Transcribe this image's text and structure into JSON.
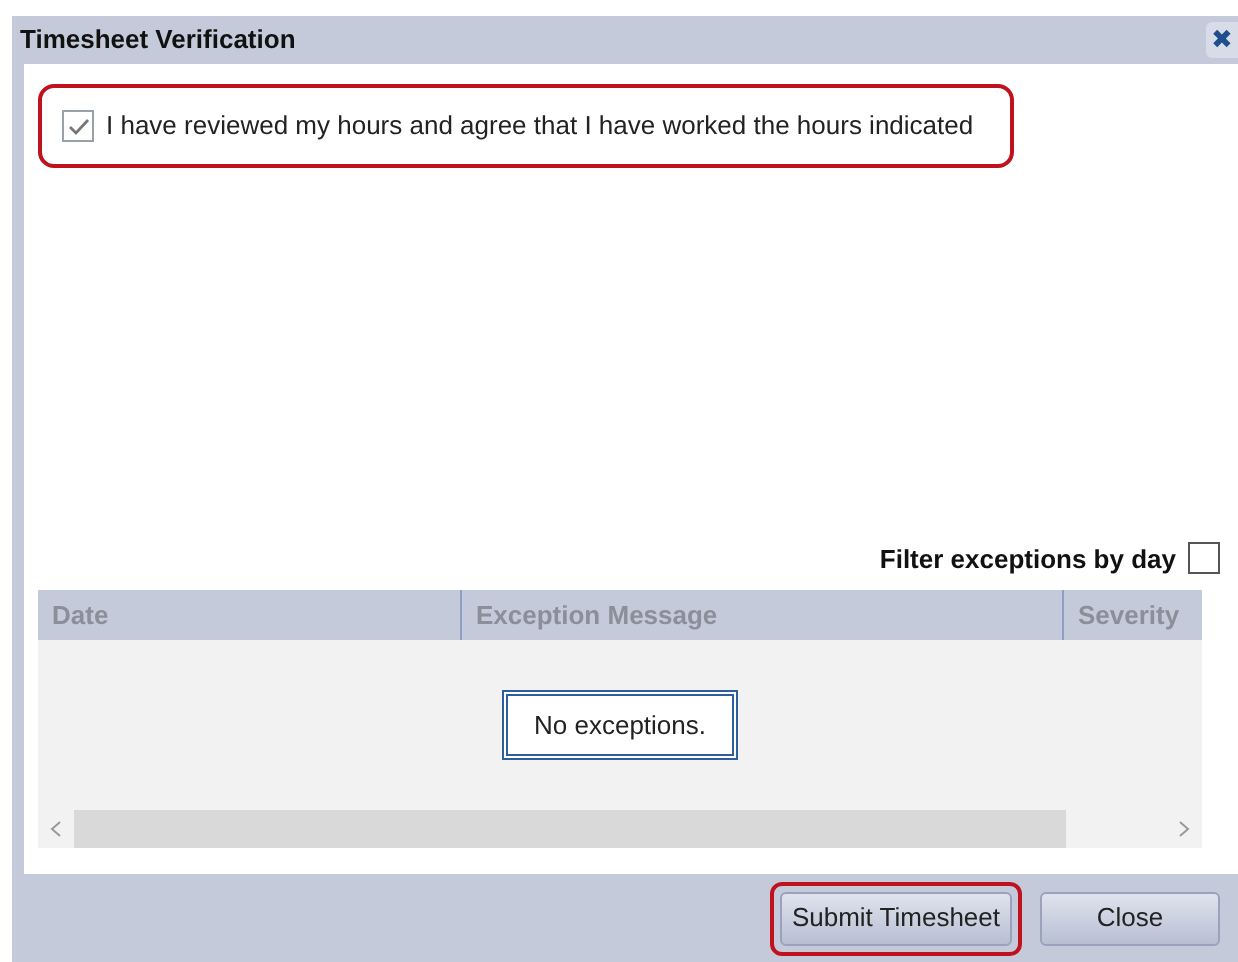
{
  "window": {
    "title": "Timesheet Verification",
    "close_glyph": "✖"
  },
  "agreement": {
    "label": "I have reviewed my hours and agree that I have worked the hours indicated",
    "checked": true,
    "highlighted": true
  },
  "filter": {
    "label": "Filter exceptions by day",
    "checked": false
  },
  "table": {
    "columns": [
      "Date",
      "Exception Message",
      "Severity"
    ],
    "empty_message": "No exceptions."
  },
  "buttons": [
    {
      "label": "Submit Timesheet",
      "highlighted": true
    },
    {
      "label": "Close",
      "highlighted": false
    }
  ]
}
